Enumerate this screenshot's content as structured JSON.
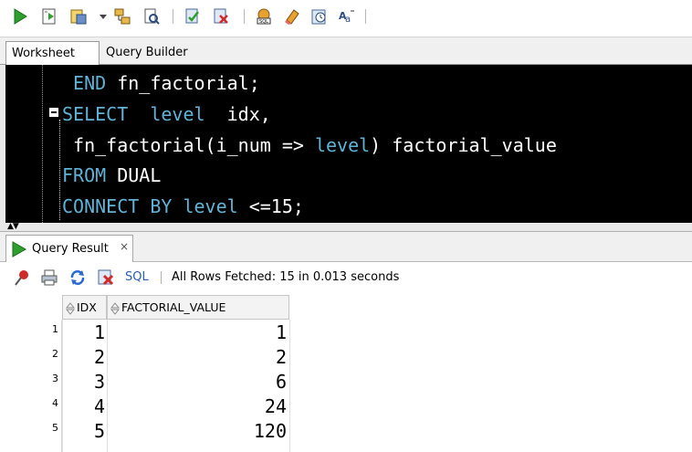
{
  "toolbar": {
    "buttons": [
      {
        "name": "run-statement-icon"
      },
      {
        "name": "run-script-icon"
      },
      {
        "name": "autotrace-icon"
      },
      {
        "name": "dropdown-arrow-icon"
      },
      {
        "name": "explain-plan-icon"
      },
      {
        "name": "sql-tuning-advisor-icon"
      },
      {
        "name": "commit-icon"
      },
      {
        "name": "rollback-icon"
      },
      {
        "name": "unshared-sql-icon"
      },
      {
        "name": "clear-eraser-icon"
      },
      {
        "name": "sql-history-icon"
      },
      {
        "name": "format-icon"
      }
    ]
  },
  "worksheet": {
    "tabs": [
      {
        "label": "Worksheet",
        "active": true
      },
      {
        "label": "Query Builder",
        "active": false
      }
    ]
  },
  "editor": {
    "lines": [
      {
        "parts": [
          {
            "text": " END ",
            "style": "kw"
          },
          {
            "text": "fn_factorial;",
            "style": "fn"
          }
        ]
      },
      {
        "parts": [
          {
            "text": "SELECT  level  ",
            "style": "kw"
          },
          {
            "text": "idx,",
            "style": "fn"
          }
        ]
      },
      {
        "parts": [
          {
            "text": " fn_factorial(i_num => ",
            "style": "fn"
          },
          {
            "text": "level",
            "style": "kw"
          },
          {
            "text": ") factorial_value",
            "style": "fn"
          }
        ]
      },
      {
        "parts": [
          {
            "text": "FROM ",
            "style": "kw"
          },
          {
            "text": "DUAL",
            "style": "fn"
          }
        ]
      },
      {
        "parts": [
          {
            "text": "CONNECT BY level ",
            "style": "kw"
          },
          {
            "text": "<=15;",
            "style": "fn"
          }
        ]
      }
    ]
  },
  "results": {
    "tab_label": "Query Result",
    "tab_close": "×",
    "sql_link": "SQL",
    "status": "All Rows Fetched: 15 in 0.013 seconds",
    "columns": [
      "IDX",
      "FACTORIAL_VALUE"
    ],
    "rows": [
      {
        "num": "1",
        "idx": "1",
        "value": "1"
      },
      {
        "num": "2",
        "idx": "2",
        "value": "2"
      },
      {
        "num": "3",
        "idx": "3",
        "value": "6"
      },
      {
        "num": "4",
        "idx": "4",
        "value": "24"
      },
      {
        "num": "5",
        "idx": "5",
        "value": "120"
      }
    ]
  },
  "colors": {
    "keyword": "#5fb3d6",
    "identifier": "#ffffff",
    "editor_bg": "#000000",
    "sql_link": "#2a5fb8"
  }
}
